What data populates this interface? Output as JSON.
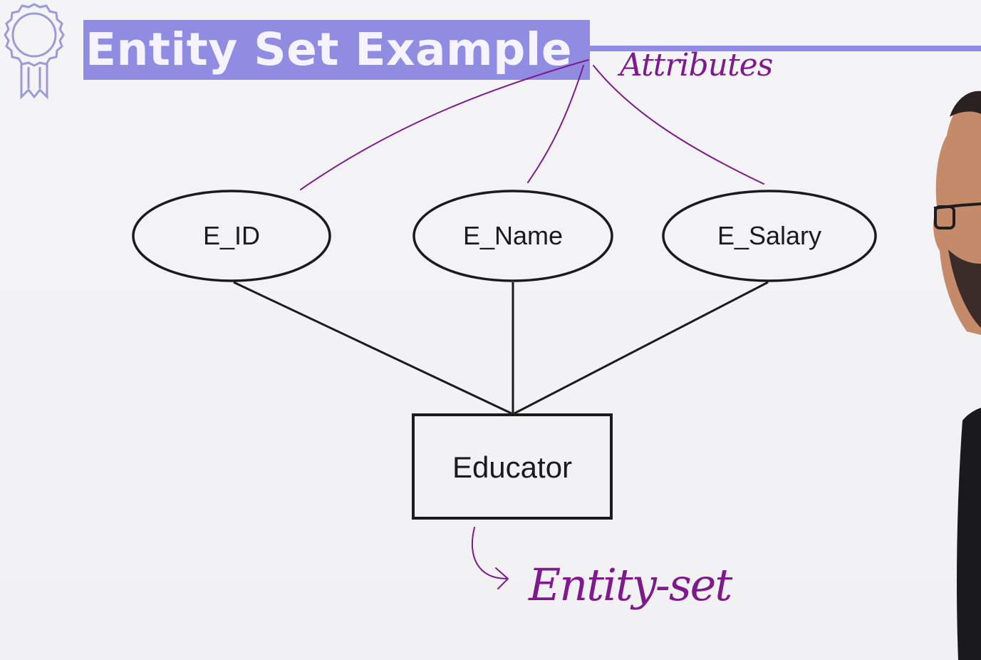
{
  "slide": {
    "title": "Entity Set Example",
    "colors": {
      "title_highlight": "#8f8ce2",
      "title_text": "#f4f3ff",
      "ink": "#1b1b1b",
      "annotation": "#7e1a8c",
      "background": "#f2f2f4"
    }
  },
  "diagram": {
    "attributes": [
      {
        "label": "E_ID"
      },
      {
        "label": "E_Name"
      },
      {
        "label": "E_Salary"
      }
    ],
    "entity": {
      "label": "Educator"
    }
  },
  "annotations": {
    "attributes_note": "Attributes",
    "entity_set_note": "Entity-set"
  },
  "icons": {
    "badge": "award-ribbon-icon"
  }
}
